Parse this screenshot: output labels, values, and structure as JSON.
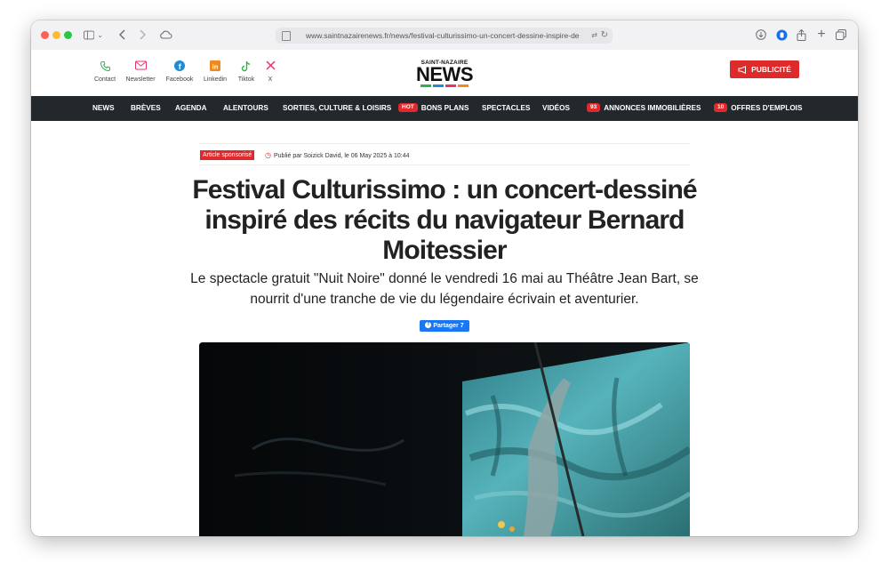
{
  "browser": {
    "url": "www.saintnazairenews.fr/news/festival-culturissimo-un-concert-dessine-inspire-de"
  },
  "header": {
    "social": [
      {
        "label": "Contact",
        "icon": "phone-icon",
        "color": "#2bb24c"
      },
      {
        "label": "Newsletter",
        "icon": "mail-icon",
        "color": "#e6336b"
      },
      {
        "label": "Facebook",
        "icon": "facebook-icon",
        "color": "#1a8cd8"
      },
      {
        "label": "Linkedin",
        "icon": "linkedin-icon",
        "color": "#f08a1d"
      },
      {
        "label": "Tiktok",
        "icon": "tiktok-icon",
        "color": "#2bb24c"
      },
      {
        "label": "X",
        "icon": "x-icon",
        "color": "#e6336b"
      }
    ],
    "logo_top": "SAINT-NAZAIRE",
    "logo_main": "NEWS",
    "logo_colors": [
      "#2bb24c",
      "#1a8cd8",
      "#e6336b",
      "#f08a1d"
    ],
    "pub_label": "PUBLICITÉ"
  },
  "nav": {
    "items": [
      {
        "label": "NEWS"
      },
      {
        "label": "BRÈVES"
      },
      {
        "label": "AGENDA"
      },
      {
        "label": "ALENTOURS"
      },
      {
        "label": "SORTIES, CULTURE & LOISIRS"
      },
      {
        "label": "BONS PLANS",
        "badge": "HOT"
      },
      {
        "label": "SPECTACLES"
      },
      {
        "label": "VIDÉOS"
      },
      {
        "label": "ANNONCES IMMOBILIÈRES",
        "badge": "93"
      },
      {
        "label": "OFFRES D'EMPLOIS",
        "badge": "10"
      }
    ]
  },
  "article": {
    "sponsored": "Article sponsorisé",
    "published": "Publié par Soizick David, le 06 May 2025 à 10:44",
    "title": "Festival Culturissimo : un concert-dessiné inspiré des récits du navigateur Bernard Moitessier",
    "subtitle": "Le spectacle gratuit \"Nuit Noire\" donné le vendredi 16 mai au Théâtre Jean Bart, se nourrit d'une tranche de vie du légendaire écrivain et aventurier.",
    "share_label": "Partager 7"
  }
}
